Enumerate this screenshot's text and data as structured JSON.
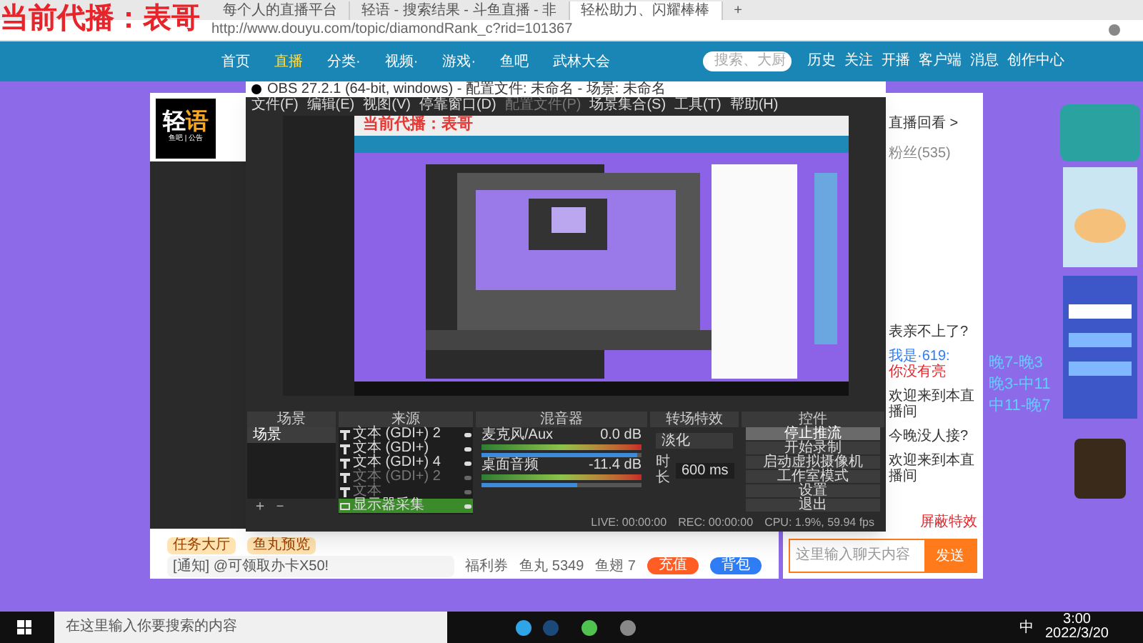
{
  "overlay_caption": "当前代播：表哥",
  "browser": {
    "tabs": [
      {
        "label": "每个人的直播平台",
        "selected": false
      },
      {
        "label": "轻语 - 搜索结果 - 斗鱼直播 - 非",
        "selected": false
      },
      {
        "label": "轻松助力、闪耀棒棒",
        "selected": true
      }
    ],
    "new_tab": "+",
    "url": "http://www.douyu.com/topic/diamondRank_c?rid=101367"
  },
  "site_nav": {
    "items": [
      {
        "label": "首页",
        "selected": false
      },
      {
        "label": "直播",
        "selected": true
      },
      {
        "label": "分类·",
        "selected": false
      },
      {
        "label": "视频·",
        "selected": false
      },
      {
        "label": "游戏·",
        "selected": false
      },
      {
        "label": "鱼吧",
        "selected": false
      },
      {
        "label": "武林大会",
        "selected": false
      }
    ],
    "search_placeholder": "搜索、大厨",
    "actions": [
      "历史",
      "关注",
      "开播",
      "客户端",
      "消息",
      "创作中心"
    ]
  },
  "room": {
    "logo": [
      "轻",
      "语"
    ],
    "logo_sub": "鱼吧 | 公告",
    "tasks": [
      "任务大厅",
      "鱼丸预览"
    ],
    "notice": "[通知] @可领取办卡X50!",
    "wallet": [
      "福利券",
      "鱼丸 5349",
      "鱼翅 7"
    ],
    "recharge": "充值",
    "backpack": "背包"
  },
  "obs": {
    "title": "OBS 27.2.1 (64-bit, windows) - 配置文件: 未命名 - 场景: 未命名",
    "menu": [
      {
        "label": "文件(F)",
        "disabled": false
      },
      {
        "label": "编辑(E)",
        "disabled": false
      },
      {
        "label": "视图(V)",
        "disabled": false
      },
      {
        "label": "停靠窗口(D)",
        "disabled": false
      },
      {
        "label": "配置文件(P)",
        "disabled": true
      },
      {
        "label": "场景集合(S)",
        "disabled": false
      },
      {
        "label": "工具(T)",
        "disabled": false
      },
      {
        "label": "帮助(H)",
        "disabled": false
      }
    ],
    "preview_caption": "当前代播：表哥",
    "scenes": {
      "title": "场景",
      "items": [
        {
          "label": "场景",
          "selected": true
        }
      ],
      "buttons": [
        "＋",
        "－"
      ]
    },
    "sources": {
      "title": "来源",
      "items": [
        {
          "label": "文本 (GDI+) 2",
          "visible": true,
          "kind": "text",
          "selected": false
        },
        {
          "label": "文本 (GDI+)",
          "visible": true,
          "kind": "text",
          "selected": false
        },
        {
          "label": "文本 (GDI+) 4",
          "visible": true,
          "kind": "text",
          "selected": false
        },
        {
          "label": "文本 (GDI+) 2",
          "visible": false,
          "kind": "text",
          "selected": false
        },
        {
          "label": "文本",
          "visible": false,
          "kind": "text",
          "selected": false
        },
        {
          "label": "显示器采集",
          "visible": true,
          "kind": "display",
          "selected": true
        }
      ]
    },
    "mixer": {
      "title": "混音器",
      "channels": [
        {
          "name": "麦克风/Aux",
          "reading": "0.0 dB",
          "level": 0.97
        },
        {
          "name": "桌面音频",
          "reading": "-11.4 dB",
          "level": 0.6
        }
      ]
    },
    "transitions": {
      "title": "转场特效",
      "type": "淡化",
      "duration_label": "时长",
      "duration": "600 ms"
    },
    "controls": {
      "title": "控件",
      "buttons": [
        {
          "label": "停止推流",
          "selected": true
        },
        {
          "label": "开始录制",
          "selected": false
        },
        {
          "label": "启动虚拟摄像机",
          "selected": false
        },
        {
          "label": "工作室模式",
          "selected": false
        },
        {
          "label": "设置",
          "selected": false
        },
        {
          "label": "退出",
          "selected": false
        }
      ]
    },
    "status": [
      "LIVE: 00:00:00",
      "REC: 00:00:00",
      "CPU: 1.9%, 59.94 fps"
    ]
  },
  "chat": {
    "replay": "直播回看 >",
    "tabs": [
      {
        "label": "粉丝(535)",
        "selected": false
      }
    ],
    "messages": [
      {
        "text": "表亲不上了?"
      },
      {
        "user": "我是·619:",
        "text": "你没有亮"
      },
      {
        "text": "欢迎来到本直播间"
      },
      {
        "text": "今晚没人接?"
      },
      {
        "text": "欢迎来到本直播间"
      }
    ],
    "block_effects": "屏蔽特效",
    "input_placeholder": "这里输入聊天内容",
    "send": "发送"
  },
  "schedule": [
    "晚7-晚3",
    "晚3-中11",
    "中11-晚7"
  ],
  "taskbar": {
    "search_placeholder": "在这里输入你要搜索的内容",
    "ime": "中",
    "time": "3:00",
    "date": "2022/3/20"
  }
}
